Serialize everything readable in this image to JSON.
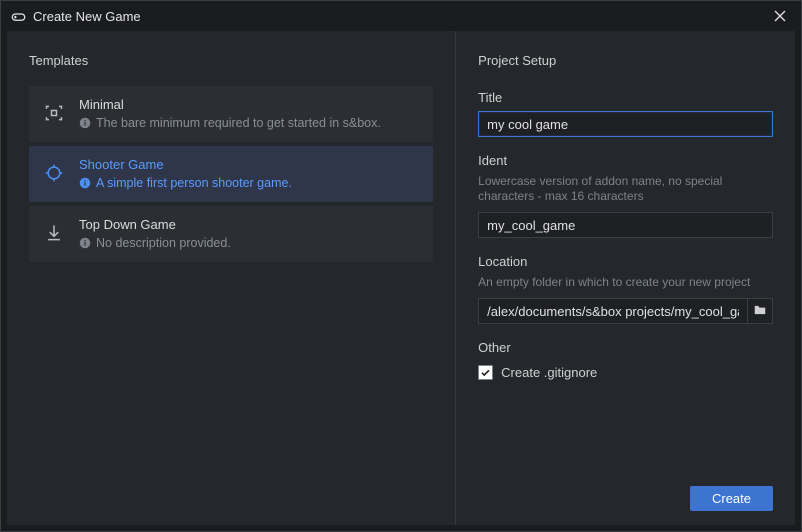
{
  "window": {
    "title": "Create New Game"
  },
  "templates": {
    "heading": "Templates",
    "items": [
      {
        "name": "Minimal",
        "desc": "The bare minimum required to get started in s&box.",
        "icon": "scan"
      },
      {
        "name": "Shooter Game",
        "desc": "A simple first person shooter game.",
        "icon": "crosshair"
      },
      {
        "name": "Top Down Game",
        "desc": "No description provided.",
        "icon": "download"
      }
    ],
    "selected_index": 1
  },
  "setup": {
    "heading": "Project Setup",
    "title_label": "Title",
    "title_value": "my cool game",
    "ident_label": "Ident",
    "ident_help": "Lowercase version of addon name, no special characters - max 16 characters",
    "ident_value": "my_cool_game",
    "location_label": "Location",
    "location_help": "An empty folder in which to create your new project",
    "location_value": "/alex/documents/s&box projects/my_cool_game",
    "other_label": "Other",
    "gitignore_label": "Create .gitignore",
    "gitignore_checked": true,
    "create_label": "Create"
  }
}
